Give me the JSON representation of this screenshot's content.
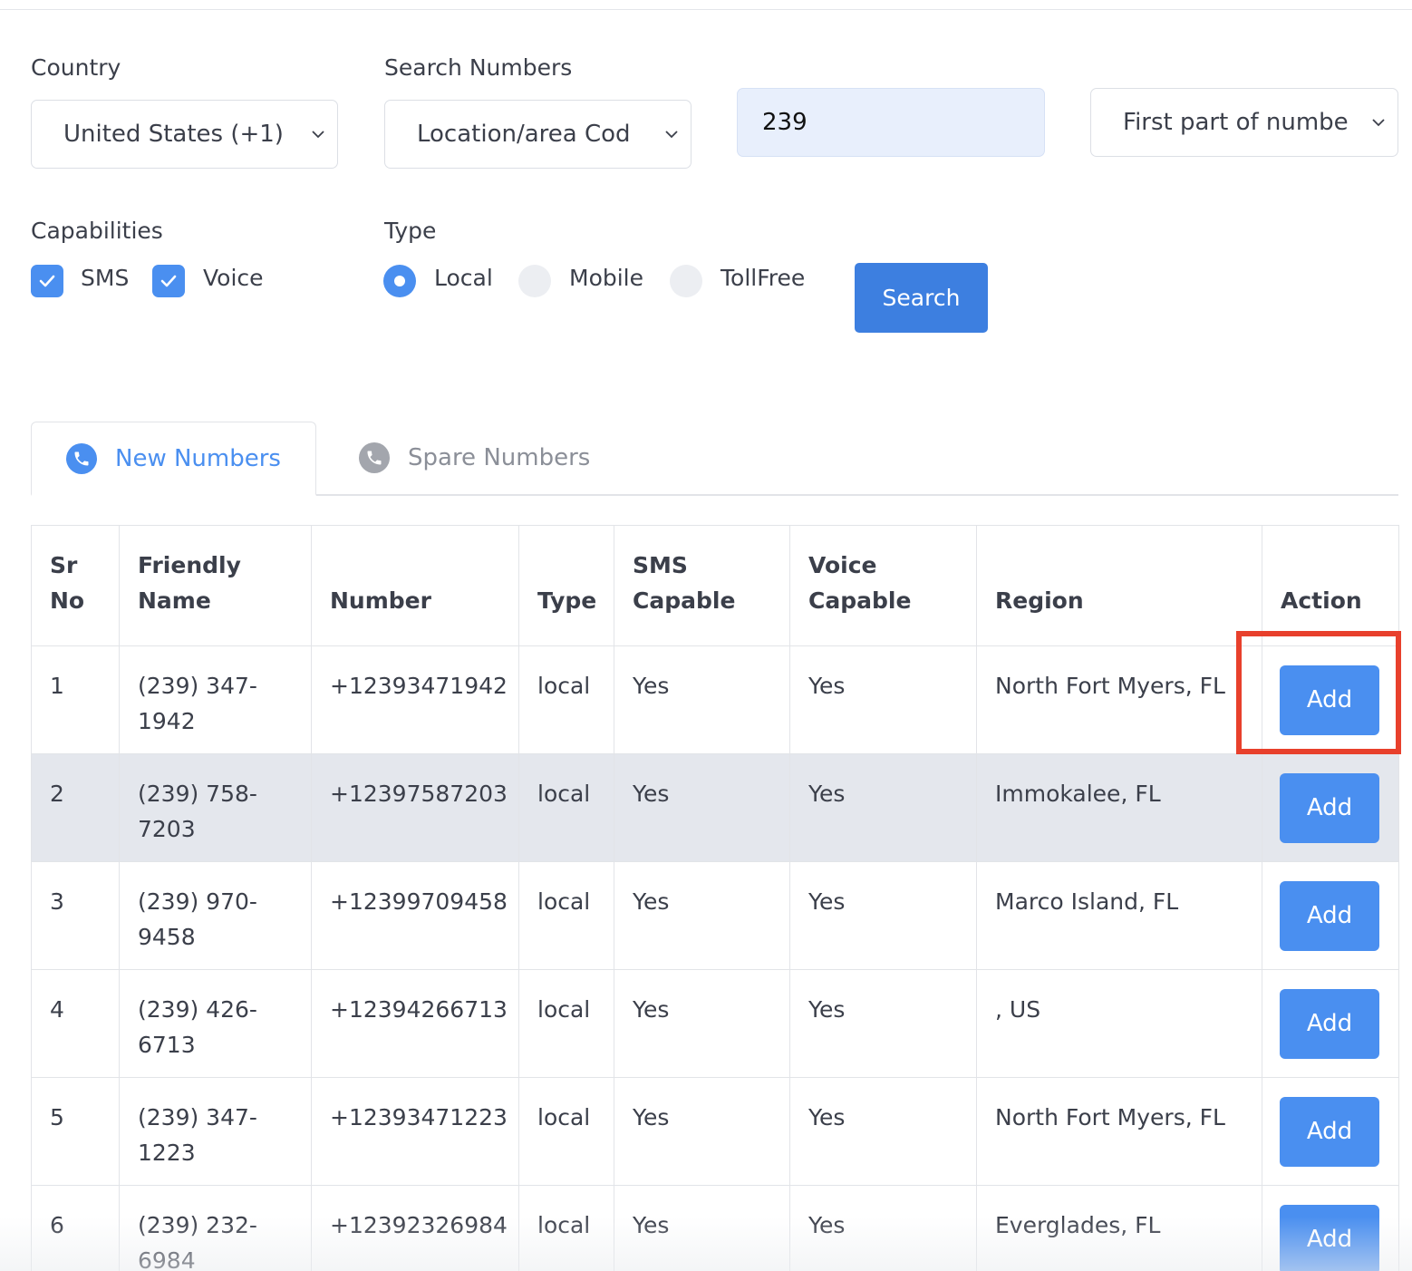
{
  "form": {
    "country_label": "Country",
    "country_value": "United States (+1)",
    "search_numbers_label": "Search Numbers",
    "search_by_value": "Location/area Cod",
    "search_input_value": "239",
    "match_mode_value": "First part of numbe",
    "capabilities_label": "Capabilities",
    "capabilities": [
      {
        "label": "SMS",
        "checked": true
      },
      {
        "label": "Voice",
        "checked": true
      }
    ],
    "type_label": "Type",
    "types": [
      {
        "label": "Local",
        "selected": true
      },
      {
        "label": "Mobile",
        "selected": false
      },
      {
        "label": "TollFree",
        "selected": false
      }
    ],
    "search_button": "Search"
  },
  "tabs": [
    {
      "label": "New Numbers",
      "icon": "phone-icon",
      "active": true
    },
    {
      "label": "Spare Numbers",
      "icon": "phone-icon",
      "active": false
    }
  ],
  "table": {
    "headers": [
      "Sr No",
      "Friendly Name",
      "Number",
      "Type",
      "SMS Capable",
      "Voice Capable",
      "Region",
      "Action"
    ],
    "rows": [
      {
        "sr": "1",
        "friendly": "(239) 347-1942",
        "number": "+12393471942",
        "type": "local",
        "sms": "Yes",
        "voice": "Yes",
        "region": "North Fort Myers, FL",
        "action": "Add"
      },
      {
        "sr": "2",
        "friendly": "(239) 758-7203",
        "number": "+12397587203",
        "type": "local",
        "sms": "Yes",
        "voice": "Yes",
        "region": "Immokalee, FL",
        "action": "Add"
      },
      {
        "sr": "3",
        "friendly": "(239) 970-9458",
        "number": "+12399709458",
        "type": "local",
        "sms": "Yes",
        "voice": "Yes",
        "region": "Marco Island, FL",
        "action": "Add"
      },
      {
        "sr": "4",
        "friendly": "(239) 426-6713",
        "number": "+12394266713",
        "type": "local",
        "sms": "Yes",
        "voice": "Yes",
        "region": ", US",
        "action": "Add"
      },
      {
        "sr": "5",
        "friendly": "(239) 347-1223",
        "number": "+12393471223",
        "type": "local",
        "sms": "Yes",
        "voice": "Yes",
        "region": "North Fort Myers, FL",
        "action": "Add"
      },
      {
        "sr": "6",
        "friendly": "(239) 232-6984",
        "number": "+12392326984",
        "type": "local",
        "sms": "Yes",
        "voice": "Yes",
        "region": "Everglades, FL",
        "action": "Add"
      }
    ]
  },
  "colors": {
    "accent": "#4a8ff0",
    "search_button": "#3d7fe0",
    "highlight_box": "#e8402c",
    "hover_row": "#e4e7ed"
  }
}
